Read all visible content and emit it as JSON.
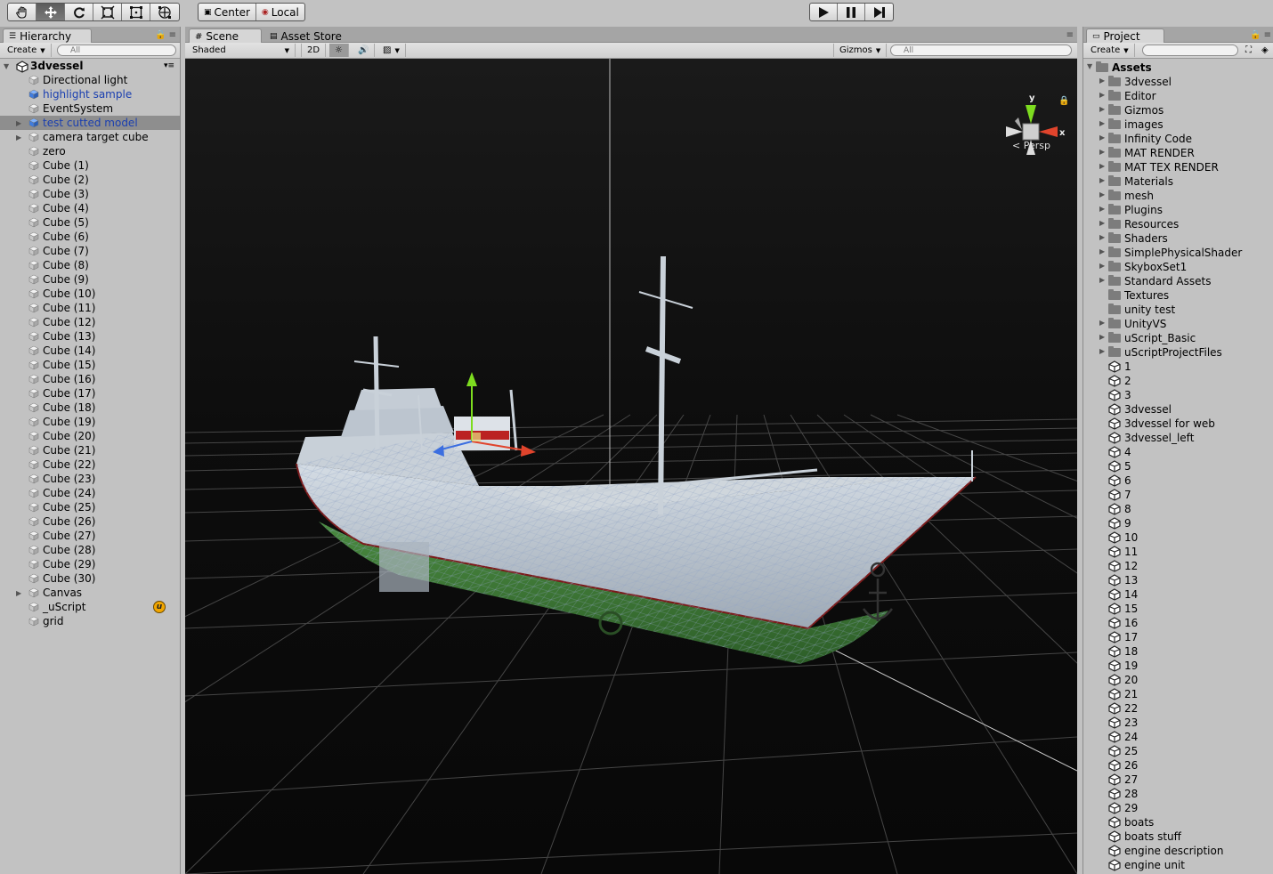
{
  "toolbar": {
    "tools": [
      "hand-icon",
      "move-icon",
      "rotate-icon",
      "scale-icon",
      "rect-icon",
      "transform-icon"
    ],
    "active_tool": "move-icon",
    "pivot": "Center",
    "space": "Local",
    "playback": [
      "play-icon",
      "pause-icon",
      "step-icon"
    ]
  },
  "hierarchy": {
    "tab": "Hierarchy",
    "create": "Create",
    "search_placeholder": "All",
    "scene": "3dvessel",
    "items": [
      {
        "label": "Directional light",
        "expandable": false,
        "type": "object"
      },
      {
        "label": "highlight sample",
        "expandable": false,
        "type": "prefab"
      },
      {
        "label": "EventSystem",
        "expandable": false,
        "type": "object"
      },
      {
        "label": "test cutted model",
        "expandable": true,
        "type": "prefab",
        "selected": true
      },
      {
        "label": "camera target cube",
        "expandable": true,
        "type": "object"
      },
      {
        "label": "zero",
        "expandable": false,
        "type": "object"
      },
      {
        "label": "Cube (1)",
        "expandable": false,
        "type": "object"
      },
      {
        "label": "Cube (2)",
        "expandable": false,
        "type": "object"
      },
      {
        "label": "Cube (3)",
        "expandable": false,
        "type": "object"
      },
      {
        "label": "Cube (4)",
        "expandable": false,
        "type": "object"
      },
      {
        "label": "Cube (5)",
        "expandable": false,
        "type": "object"
      },
      {
        "label": "Cube (6)",
        "expandable": false,
        "type": "object"
      },
      {
        "label": "Cube (7)",
        "expandable": false,
        "type": "object"
      },
      {
        "label": "Cube (8)",
        "expandable": false,
        "type": "object"
      },
      {
        "label": "Cube (9)",
        "expandable": false,
        "type": "object"
      },
      {
        "label": "Cube (10)",
        "expandable": false,
        "type": "object"
      },
      {
        "label": "Cube (11)",
        "expandable": false,
        "type": "object"
      },
      {
        "label": "Cube (12)",
        "expandable": false,
        "type": "object"
      },
      {
        "label": "Cube (13)",
        "expandable": false,
        "type": "object"
      },
      {
        "label": "Cube (14)",
        "expandable": false,
        "type": "object"
      },
      {
        "label": "Cube (15)",
        "expandable": false,
        "type": "object"
      },
      {
        "label": "Cube (16)",
        "expandable": false,
        "type": "object"
      },
      {
        "label": "Cube (17)",
        "expandable": false,
        "type": "object"
      },
      {
        "label": "Cube (18)",
        "expandable": false,
        "type": "object"
      },
      {
        "label": "Cube (19)",
        "expandable": false,
        "type": "object"
      },
      {
        "label": "Cube (20)",
        "expandable": false,
        "type": "object"
      },
      {
        "label": "Cube (21)",
        "expandable": false,
        "type": "object"
      },
      {
        "label": "Cube (22)",
        "expandable": false,
        "type": "object"
      },
      {
        "label": "Cube (23)",
        "expandable": false,
        "type": "object"
      },
      {
        "label": "Cube (24)",
        "expandable": false,
        "type": "object"
      },
      {
        "label": "Cube (25)",
        "expandable": false,
        "type": "object"
      },
      {
        "label": "Cube (26)",
        "expandable": false,
        "type": "object"
      },
      {
        "label": "Cube (27)",
        "expandable": false,
        "type": "object"
      },
      {
        "label": "Cube (28)",
        "expandable": false,
        "type": "object"
      },
      {
        "label": "Cube (29)",
        "expandable": false,
        "type": "object"
      },
      {
        "label": "Cube (30)",
        "expandable": false,
        "type": "object"
      },
      {
        "label": "Canvas",
        "expandable": true,
        "type": "object"
      },
      {
        "label": "_uScript",
        "expandable": false,
        "type": "object",
        "badge": "u"
      },
      {
        "label": "grid",
        "expandable": false,
        "type": "object"
      }
    ]
  },
  "scene": {
    "tabs": [
      "Scene",
      "Asset Store"
    ],
    "draw_mode": "Shaded",
    "mode_2d": "2D",
    "gizmos": "Gizmos",
    "search_placeholder": "All",
    "gizmo_axes": {
      "y": "y",
      "x": "x"
    },
    "projection": "Persp",
    "colors": {
      "background": "#141414",
      "grid": "#4a4a4a",
      "hull_upper": "#b8c3cc",
      "hull_lower": "#3e7a36",
      "axis_y": "#7ddc1f",
      "axis_x": "#e0442c",
      "axis_z": "#3b6ee0"
    }
  },
  "project": {
    "tab": "Project",
    "create": "Create",
    "root": "Assets",
    "folders": [
      {
        "label": "3dvessel",
        "expandable": true
      },
      {
        "label": "Editor",
        "expandable": true
      },
      {
        "label": "Gizmos",
        "expandable": true
      },
      {
        "label": "images",
        "expandable": true
      },
      {
        "label": "Infinity Code",
        "expandable": true
      },
      {
        "label": "MAT RENDER",
        "expandable": true
      },
      {
        "label": "MAT TEX RENDER",
        "expandable": true
      },
      {
        "label": "Materials",
        "expandable": true
      },
      {
        "label": "mesh",
        "expandable": true
      },
      {
        "label": "Plugins",
        "expandable": true
      },
      {
        "label": "Resources",
        "expandable": true
      },
      {
        "label": "Shaders",
        "expandable": true
      },
      {
        "label": "SimplePhysicalShader",
        "expandable": true
      },
      {
        "label": "SkyboxSet1",
        "expandable": true
      },
      {
        "label": "Standard Assets",
        "expandable": true
      },
      {
        "label": "Textures",
        "expandable": false
      },
      {
        "label": "unity test",
        "expandable": false
      },
      {
        "label": "UnityVS",
        "expandable": true
      },
      {
        "label": "uScript_Basic",
        "expandable": true
      },
      {
        "label": "uScriptProjectFiles",
        "expandable": true
      }
    ],
    "scenes": [
      "1",
      "2",
      "3",
      "3dvessel",
      "3dvessel for web",
      "3dvessel_left",
      "4",
      "5",
      "6",
      "7",
      "8",
      "9",
      "10",
      "11",
      "12",
      "13",
      "14",
      "15",
      "16",
      "17",
      "18",
      "19",
      "20",
      "21",
      "22",
      "23",
      "24",
      "25",
      "26",
      "27",
      "28",
      "29",
      "boats",
      "boats stuff",
      "engine description",
      "engine unit"
    ]
  }
}
